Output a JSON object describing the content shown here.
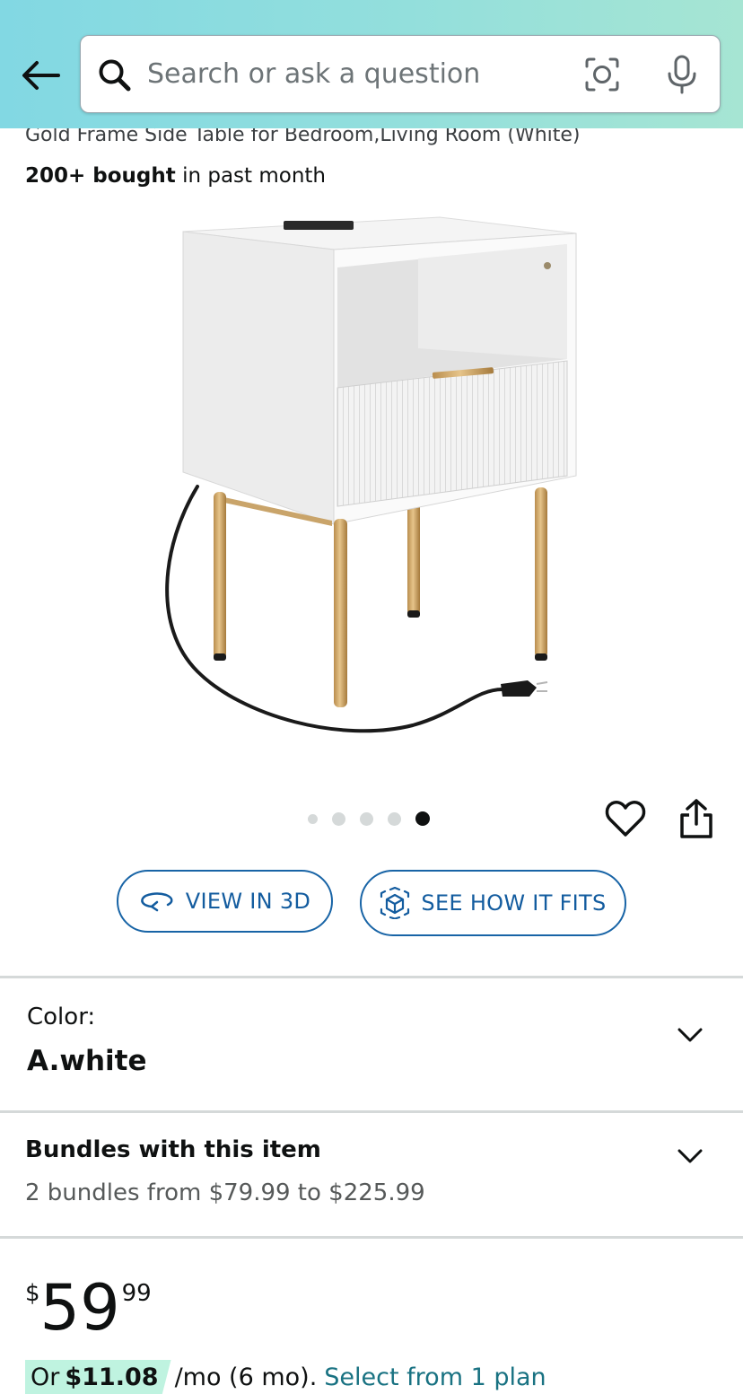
{
  "header": {
    "search_placeholder": "Search or ask a question"
  },
  "product": {
    "title_partial": "Gold Frame Side Table for Bedroom,Living Room (White)",
    "bought_bold": "200+ bought",
    "bought_rest": "in past month",
    "image_count": 5,
    "active_image_index": 5
  },
  "actions": {
    "view_3d": "VIEW IN 3D",
    "see_how_it_fits": "SEE HOW IT FITS"
  },
  "color": {
    "label": "Color:",
    "value": "A.white"
  },
  "bundles": {
    "title": "Bundles with this item",
    "subtitle": "2 bundles from $79.99 to $225.99"
  },
  "price": {
    "symbol": "$",
    "whole": "59",
    "fraction": "99"
  },
  "monthly": {
    "prefix": "Or",
    "amount": "$11.08",
    "term": "/mo (6 mo).",
    "link": "Select from 1 plan"
  },
  "colors": {
    "link_blue": "#135c9f",
    "teal_link": "#197282",
    "header_gradient_start": "#82d8e3",
    "header_gradient_end": "#a6e5d3",
    "pay_tag_bg": "#bff3e0"
  },
  "icons": {
    "back": "arrow-left-icon",
    "search": "search-icon",
    "camera": "camera-lens-icon",
    "mic": "microphone-icon",
    "heart": "heart-icon",
    "share": "share-icon",
    "rotate_3d": "rotate-3d-icon",
    "ar_cube": "ar-cube-icon",
    "chevron": "chevron-down-icon"
  }
}
